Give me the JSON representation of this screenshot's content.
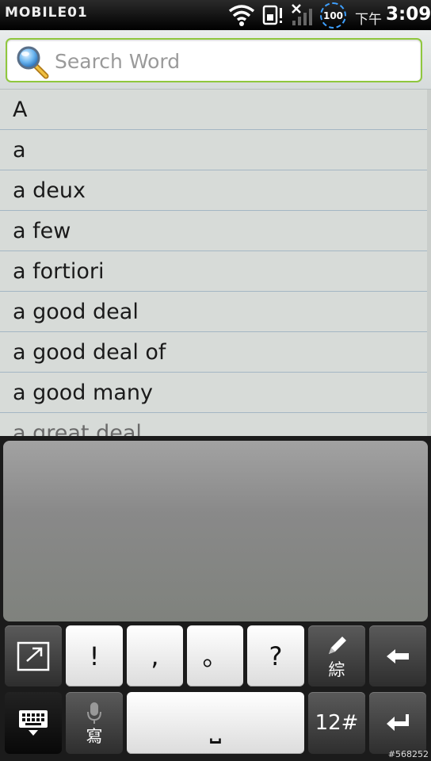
{
  "statusbar": {
    "carrier": "MOBILE01",
    "battery": "100",
    "time_prefix": "下午",
    "time": "3:09"
  },
  "search": {
    "placeholder": "Search Word",
    "value": ""
  },
  "words": [
    "A",
    "a",
    "a deux",
    "a few",
    "a fortiori",
    "a good deal",
    "a good deal of",
    "a good many",
    "a great deal"
  ],
  "keyboard": {
    "row1": {
      "key1": "!",
      "key2": ",",
      "key3": "。",
      "key4": "?",
      "handwrite_label": "綜"
    },
    "row2": {
      "voice_label": "寫",
      "space": "⎵",
      "numbers": "12#"
    }
  },
  "watermark": "#568252"
}
